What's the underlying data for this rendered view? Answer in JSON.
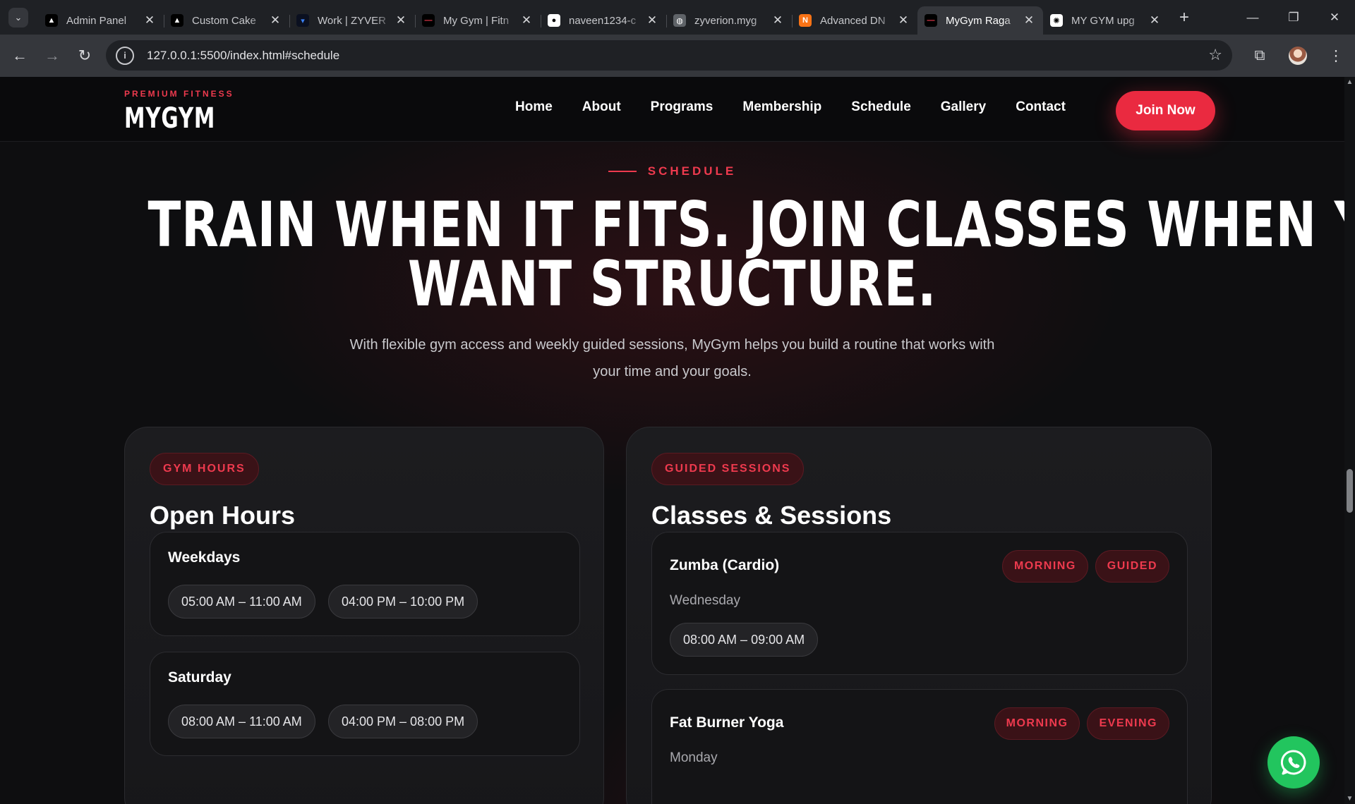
{
  "browser": {
    "tabs": [
      {
        "title": "Admin Panel",
        "icon": "triangle-icon",
        "fav_bg": "#000000",
        "fav_fg": "#ffffff",
        "glyph": "▲"
      },
      {
        "title": "Custom Cake",
        "icon": "triangle-icon",
        "fav_bg": "#000000",
        "fav_fg": "#ffffff",
        "glyph": "▲"
      },
      {
        "title": "Work | ZYVER",
        "icon": "zyver-icon",
        "fav_bg": "#0b1020",
        "fav_fg": "#3b82f6",
        "glyph": "▾"
      },
      {
        "title": "My Gym | Fitn",
        "icon": "mygym-icon",
        "fav_bg": "#000000",
        "fav_fg": "#ee3a4e",
        "glyph": "—"
      },
      {
        "title": "naveen1234-c",
        "icon": "github-icon",
        "fav_bg": "#ffffff",
        "fav_fg": "#000000",
        "glyph": "●"
      },
      {
        "title": "zyverion.myg",
        "icon": "globe-icon",
        "fav_bg": "#5f6368",
        "fav_fg": "#ffffff",
        "glyph": "◍"
      },
      {
        "title": "Advanced DN",
        "icon": "advanced-icon",
        "fav_bg": "#f97316",
        "fav_fg": "#ffffff",
        "glyph": "N"
      },
      {
        "title": "MyGym Raga",
        "icon": "mygym-icon",
        "fav_bg": "#000000",
        "fav_fg": "#ee3a4e",
        "glyph": "—",
        "active": true
      },
      {
        "title": "MY GYM upg",
        "icon": "openai-icon",
        "fav_bg": "#ffffff",
        "fav_fg": "#000000",
        "glyph": "✺"
      }
    ],
    "url": "127.0.0.1:5500/index.html#schedule"
  },
  "header": {
    "tagline": "PREMIUM FITNESS",
    "brand": "MYGYM",
    "nav": [
      "Home",
      "About",
      "Programs",
      "Membership",
      "Schedule",
      "Gallery",
      "Contact"
    ],
    "cta": "Join Now"
  },
  "hero": {
    "eyebrow": "SCHEDULE",
    "title_line1": "TRAIN WHEN IT FITS. JOIN CLASSES WHEN YOU",
    "title_line2": "WANT STRUCTURE.",
    "description": "With flexible gym access and weekly guided sessions, MyGym helps you build a routine that works with your time and your goals."
  },
  "hours": {
    "label": "GYM HOURS",
    "title": "Open Hours",
    "groups": [
      {
        "name": "Weekdays",
        "slots": [
          "05:00 AM – 11:00 AM",
          "04:00 PM – 10:00 PM"
        ]
      },
      {
        "name": "Saturday",
        "slots": [
          "08:00 AM – 11:00 AM",
          "04:00 PM – 08:00 PM"
        ]
      }
    ]
  },
  "classes": {
    "label": "GUIDED SESSIONS",
    "title": "Classes & Sessions",
    "items": [
      {
        "name": "Zumba (Cardio)",
        "day": "Wednesday",
        "tags": [
          "MORNING",
          "GUIDED"
        ],
        "slot": "08:00 AM – 09:00 AM"
      },
      {
        "name": "Fat Burner Yoga",
        "day": "Monday",
        "tags": [
          "MORNING",
          "EVENING"
        ]
      }
    ]
  },
  "colors": {
    "accent": "#ea2a40",
    "whatsapp": "#22c55e",
    "background": "#0e0e10"
  }
}
